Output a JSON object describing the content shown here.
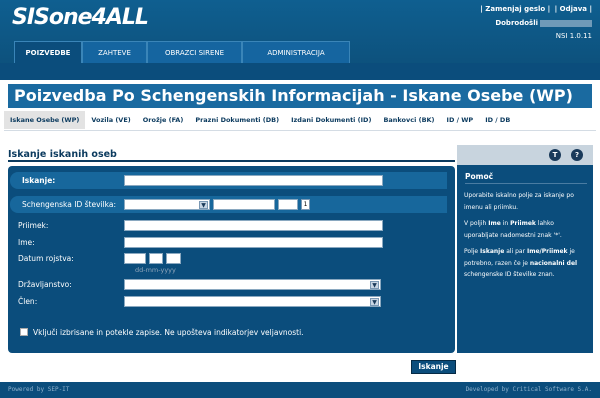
{
  "header": {
    "logo": "SISone4ALL",
    "links": [
      "| Zamenjaj geslo |",
      "| Odjava |"
    ],
    "welcome": "Dobrodošli",
    "version": "NSI 1.0.11"
  },
  "nav": {
    "tabs": [
      "POIZVEDBE",
      "ZAHTEVE",
      "OBRAZCI SIRENE",
      "ADMINISTRACIJA"
    ]
  },
  "page_title": "Poizvedba Po Schengenskih Informacijah - Iskane Osebe (WP)",
  "subnav": {
    "tabs": [
      "Iskane Osebe (WP)",
      "Vozila (VE)",
      "Orožje (FA)",
      "Prazni Dokumenti (DB)",
      "Izdani Dokumenti (ID)",
      "Bankovci (BK)",
      "ID / WP",
      "ID / DB"
    ]
  },
  "form": {
    "section_title": "Iskanje iskanih oseb",
    "iskanje_label": "Iskanje:",
    "sid_label": "Schengenska ID številka:",
    "sid_button": "1",
    "priimek_label": "Priimek:",
    "ime_label": "Ime:",
    "datum_label": "Datum rojstva:",
    "date_format": "dd-mm-yyyy",
    "drzavljanstvo_label": "Državljanstvo:",
    "clen_label": "Člen:",
    "checkbox_label": "Vključi izbrisane in potekle zapise. Ne upošteva indikatorjev veljavnosti.",
    "submit_label": "Iskanje"
  },
  "help": {
    "icon_t": "T",
    "icon_q": "?",
    "title": "Pomoč",
    "p1a": "Uporabite iskalno polje za iskanje po",
    "p1b": "imenu ali priimku.",
    "p2a": "V poljih",
    "p2b": "Ime",
    "p2c": "in",
    "p2d": "Priimek",
    "p2e": "lahko",
    "p2f": "uporabljate nadomestni znak '*'.",
    "p3a": "Polje",
    "p3b": "Iskanje",
    "p3c": "ali par",
    "p3d": "Ime/Priimek",
    "p3e": "je",
    "p3f": "potrebno, razen če je",
    "p3g": "nacionalni del",
    "p3h": "schengenske ID številke znan."
  },
  "footer": {
    "left": "Powered by SEP-IT",
    "right": "Developed by Critical Software S.A."
  }
}
